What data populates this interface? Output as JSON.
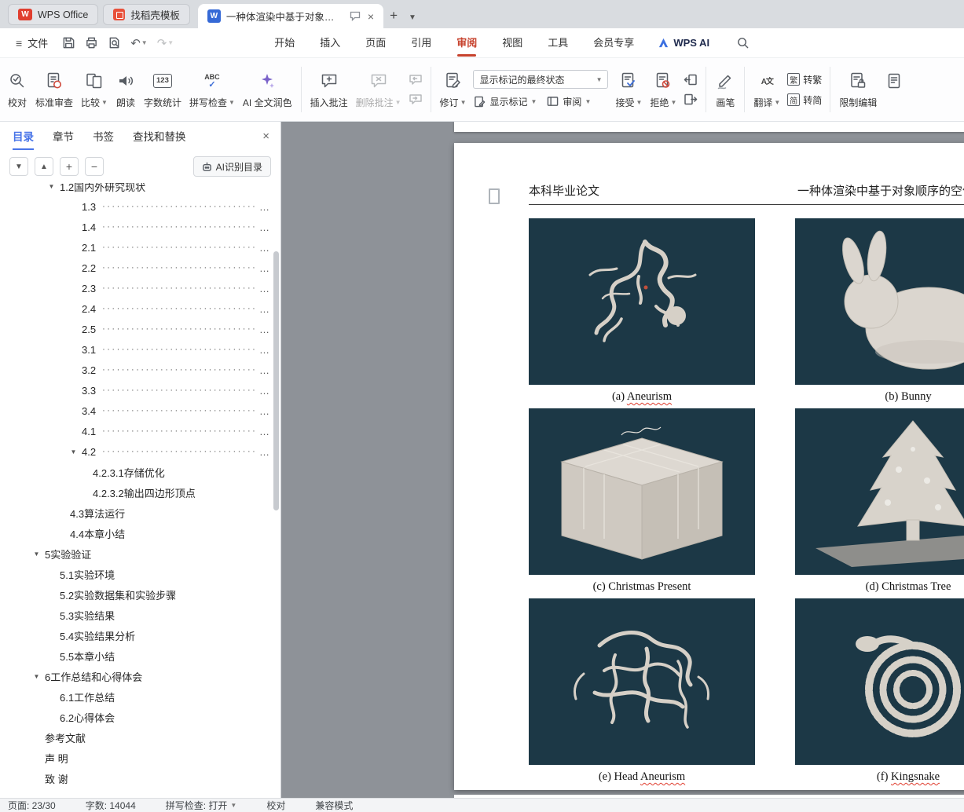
{
  "icons": {
    "w": "W"
  },
  "tabbar": {
    "home_tab": "WPS Office",
    "template_tab": "找稻壳模板",
    "doc_tab": "一种体渲染中基于对象顺序的"
  },
  "menubar": {
    "file": "文件",
    "tabs": [
      "开始",
      "插入",
      "页面",
      "引用",
      "审阅",
      "视图",
      "工具",
      "会员专享"
    ],
    "wps_ai": "WPS AI"
  },
  "ribbon": {
    "proofread": "校对",
    "standard_review": "标准审查",
    "compare": "比较",
    "read_aloud": "朗读",
    "word_count": "字数统计",
    "spell_check": "拼写检查",
    "ai_polish": "AI 全文润色",
    "insert_comment": "插入批注",
    "delete_comment": "删除批注",
    "revise": "修订",
    "markup_state": "显示标记的最终状态",
    "show_markup": "显示标记",
    "review_pane": "审阅",
    "accept": "接受",
    "reject": "拒绝",
    "pen": "画笔",
    "translate": "翻译",
    "to_traditional": "转繁",
    "to_simplified": "转简",
    "restrict_editing": "限制编辑",
    "icon_word_count": "123",
    "icon_spell": "ABC",
    "icon_translate": "A文",
    "icon_traditional": "繁",
    "icon_simplified": "简"
  },
  "panel": {
    "tabs": [
      "目录",
      "章节",
      "书签",
      "查找和替换"
    ],
    "ai_recognize": "AI识别目录",
    "toc": [
      {
        "label": "1.2国内外研究现状",
        "level": 2,
        "expanded": true
      },
      {
        "label": "1.3",
        "level": 3,
        "leader": true
      },
      {
        "label": "1.4",
        "level": 3,
        "leader": true
      },
      {
        "label": "2.1",
        "level": 3,
        "leader": true
      },
      {
        "label": "2.2",
        "level": 3,
        "leader": true
      },
      {
        "label": "2.3",
        "level": 3,
        "leader": true
      },
      {
        "label": "2.4",
        "level": 3,
        "leader": true
      },
      {
        "label": "2.5",
        "level": 3,
        "leader": true
      },
      {
        "label": "3.1",
        "level": 3,
        "leader": true
      },
      {
        "label": "3.2",
        "level": 3,
        "leader": true
      },
      {
        "label": "3.3",
        "level": 3,
        "leader": true
      },
      {
        "label": "3.4",
        "level": 3,
        "leader": true
      },
      {
        "label": "4.1",
        "level": 3,
        "leader": true
      },
      {
        "label": "4.2",
        "level": 3,
        "leader": true,
        "expanded": true
      },
      {
        "label": "4.2.3.1存储优化",
        "level": 4
      },
      {
        "label": "4.2.3.2输出四边形顶点",
        "level": 4
      },
      {
        "label": "4.3算法运行",
        "level": 2
      },
      {
        "label": "4.4本章小结",
        "level": 2
      },
      {
        "label": "5实验验证",
        "level": 1,
        "expanded": true
      },
      {
        "label": "5.1实验环境",
        "level": 2
      },
      {
        "label": "5.2实验数据集和实验步骤",
        "level": 2
      },
      {
        "label": "5.3实验结果",
        "level": 2
      },
      {
        "label": "5.4实验结果分析",
        "level": 2
      },
      {
        "label": "5.5本章小结",
        "level": 2
      },
      {
        "label": "6工作总结和心得体会",
        "level": 1,
        "expanded": true
      },
      {
        "label": "6.1工作总结",
        "level": 2
      },
      {
        "label": "6.2心得体会",
        "level": 2
      },
      {
        "label": "参考文献",
        "level": 1
      },
      {
        "label": "声 明",
        "level": 1
      },
      {
        "label": "致 谢",
        "level": 1
      }
    ]
  },
  "doc": {
    "header_left": "本科毕业论文",
    "header_right": "一种体渲染中基于对象顺序的空体",
    "figures": [
      {
        "prefix": "(a) ",
        "name": "Aneurism",
        "misspelled": true
      },
      {
        "prefix": "(b) ",
        "name": "Bunny",
        "misspelled": false
      },
      {
        "prefix": "(c) ",
        "name": "Christmas Present",
        "misspelled": false
      },
      {
        "prefix": "(d) ",
        "name": "Christmas Tree",
        "misspelled": false
      },
      {
        "prefix": "(e) Head ",
        "name": "Aneurism",
        "misspelled": true
      },
      {
        "prefix": "(f) ",
        "name": "Kingsnake",
        "misspelled": true
      }
    ]
  },
  "status": {
    "page": "页面: 23/30",
    "words": "字数: 14044",
    "spell": "拼写检查: 打开",
    "proofread": "校对",
    "mode": "兼容模式"
  },
  "colors": {
    "accent_red": "#c7432e",
    "panel_blue": "#4874e8",
    "figure_bg": "#1c3846"
  }
}
